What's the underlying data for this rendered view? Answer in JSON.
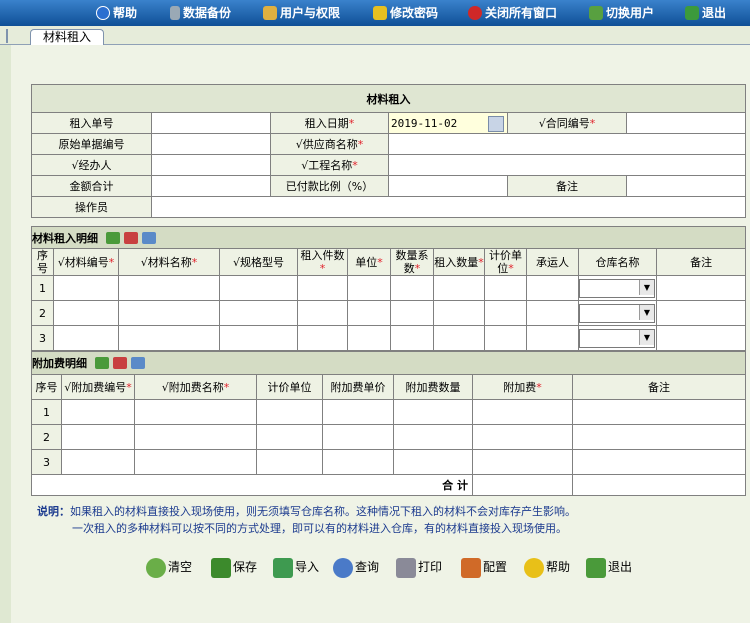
{
  "topbar": {
    "items": [
      {
        "label": "帮助",
        "icon": "help-icon"
      },
      {
        "label": "数据备份",
        "icon": "backup-icon"
      },
      {
        "label": "用户与权限",
        "icon": "users-icon"
      },
      {
        "label": "修改密码",
        "icon": "key-icon"
      },
      {
        "label": "关闭所有窗口",
        "icon": "close-all-icon"
      },
      {
        "label": "切换用户",
        "icon": "switch-user-icon"
      },
      {
        "label": "退出",
        "icon": "exit-icon"
      }
    ]
  },
  "tab": {
    "label": "材料租入"
  },
  "form": {
    "title": "材料租入",
    "rent_no_label": "租入单号",
    "rent_date_label": "租入日期",
    "rent_date_value": "2019-11-02",
    "contract_no_label": "√合同编号",
    "orig_doc_label": "原始单据编号",
    "supplier_label": "√供应商名称",
    "handler_label": "√经办人",
    "project_label": "√工程名称",
    "amount_label": "金额合计",
    "paid_ratio_label": "已付款比例（%）",
    "remark_label": "备注",
    "operator_label": "操作员",
    "required_mark": "*"
  },
  "detail": {
    "section_title": "材料租入明细",
    "columns": [
      "序号",
      "√材料编号",
      "√材料名称",
      "√规格型号",
      "租入件数",
      "单位",
      "数量系数",
      "租入数量",
      "计价单位",
      "承运人",
      "仓库名称",
      "备注"
    ],
    "rows": [
      "1",
      "2",
      "3"
    ]
  },
  "extra": {
    "section_title": "附加费明细",
    "columns": [
      "序号",
      "√附加费编号",
      "√附加费名称",
      "计价单位",
      "附加费单价",
      "附加费数量",
      "附加费",
      "备注"
    ],
    "rows": [
      "1",
      "2",
      "3"
    ],
    "total_label": "合 计"
  },
  "notes": {
    "label": "说明：",
    "line1": "如果租入的材料直接投入现场使用，则无须填写仓库名称。这种情况下租入的材料不会对库存产生影响。",
    "line2": "一次租入的多种材料可以按不同的方式处理，即可以有的材料进入仓库，有的材料直接投入现场使用。"
  },
  "buttons": [
    {
      "label": "清空",
      "icon": "clear-icon"
    },
    {
      "label": "保存",
      "icon": "save-icon"
    },
    {
      "label": "导入",
      "icon": "import-icon"
    },
    {
      "label": "查询",
      "icon": "search-icon"
    },
    {
      "label": "打印",
      "icon": "print-icon"
    },
    {
      "label": "配置",
      "icon": "config-icon"
    },
    {
      "label": "帮助",
      "icon": "help-icon"
    },
    {
      "label": "退出",
      "icon": "exit-icon"
    }
  ]
}
